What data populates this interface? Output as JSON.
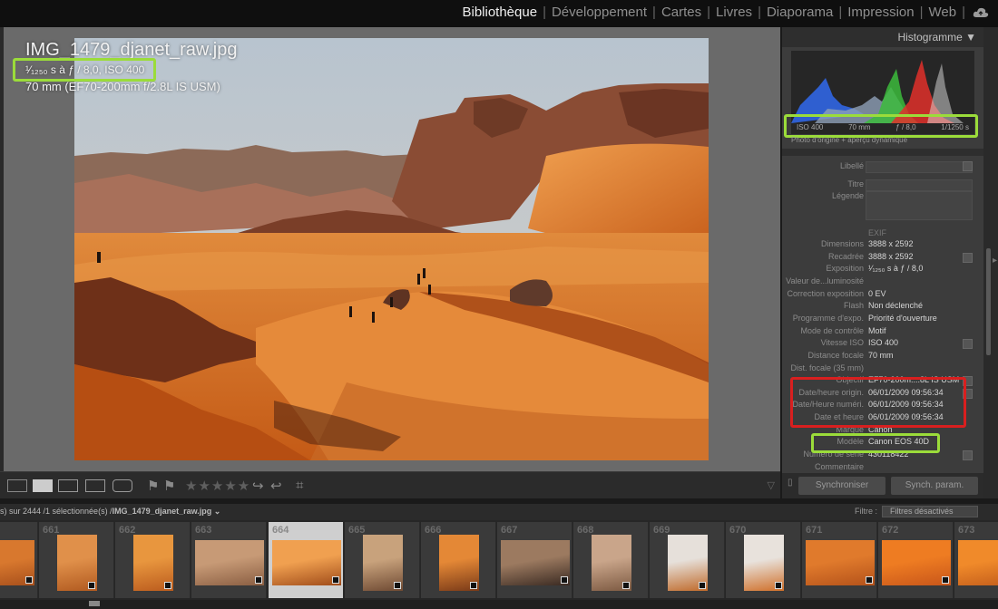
{
  "modules": [
    "Bibliothèque",
    "Développement",
    "Cartes",
    "Livres",
    "Diaporama",
    "Impression",
    "Web"
  ],
  "active_module": "Bibliothèque",
  "loupe_overlay": {
    "filename": "IMG_1479_djanet_raw.jpg",
    "exposure": "¹⁄₁₂₅₀ s à ƒ / 8,0, ISO 400",
    "lens": "70 mm (EF70-200mm f/2.8L IS USM)"
  },
  "toolbar": {
    "stars": "★★★★★"
  },
  "histogram": {
    "title": "Histogramme ▼",
    "iso": "ISO 400",
    "focal": "70 mm",
    "aperture": "ƒ / 8,0",
    "shutter": "1/1250 s",
    "source_label": "Photo d'origine + aperçu dynamique"
  },
  "metadata": {
    "libelle_label": "Libellé",
    "titre_label": "Titre",
    "legende_label": "Légende",
    "exif_header": "EXIF",
    "rows": [
      {
        "label": "Dimensions",
        "value": "3888 x 2592"
      },
      {
        "label": "Recadrée",
        "value": "3888 x 2592"
      },
      {
        "label": "Exposition",
        "value": "¹⁄₁₂₅₀ s à ƒ / 8,0"
      },
      {
        "label": "Valeur de...luminosité",
        "value": ""
      },
      {
        "label": "Correction exposition",
        "value": "0 EV"
      },
      {
        "label": "Flash",
        "value": "Non déclenché"
      },
      {
        "label": "Programme d'expo.",
        "value": "Priorité d'ouverture"
      },
      {
        "label": "Mode de contrôle",
        "value": "Motif"
      },
      {
        "label": "Vitesse ISO",
        "value": "ISO 400"
      },
      {
        "label": "Distance focale",
        "value": "70 mm"
      },
      {
        "label": "Dist. focale (35 mm)",
        "value": ""
      },
      {
        "label": "Objectif",
        "value": "EF70-200m....8L IS USM"
      },
      {
        "label": "Date/heure origin.",
        "value": "06/01/2009 09:56:34"
      },
      {
        "label": "Date/Heure numéri.",
        "value": "06/01/2009 09:56:34"
      },
      {
        "label": "Date et heure",
        "value": "06/01/2009 09:56:34"
      },
      {
        "label": "Marque",
        "value": "Canon"
      },
      {
        "label": "Modèle",
        "value": "Canon EOS 40D"
      },
      {
        "label": "Numéro de série",
        "value": "430118422"
      },
      {
        "label": "Commentaire",
        "value": ""
      }
    ]
  },
  "sync": {
    "sync_label": "Synchroniser",
    "sync_params_label": "Synch. param."
  },
  "filmstrip": {
    "status_prefix": "s) sur 2444 /1 sélectionnée(s) /",
    "status_file": "IMG_1479_djanet_raw.jpg ⌄",
    "filter_label": "Filtre :",
    "filter_value": "Filtres désactivés",
    "numbers": [
      "",
      "661",
      "662",
      "663",
      "664",
      "665",
      "666",
      "667",
      "668",
      "669",
      "670",
      "671",
      "672",
      "673"
    ],
    "selected": "664"
  },
  "colors": {
    "highlight_green": "#9bdc3a",
    "highlight_red": "#d81f1f",
    "panel_bg": "#3c3c3c",
    "viewer_bg": "#6a6a6a"
  }
}
